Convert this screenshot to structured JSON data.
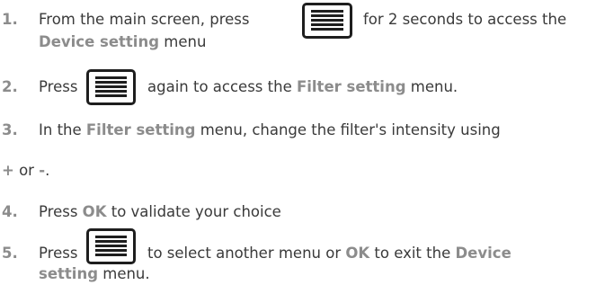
{
  "steps": [
    {
      "number": "1.",
      "line1_before": "From the main screen, press",
      "line1_after": "for 2 seconds to access the",
      "line2_highlight": "Device setting",
      "line2_after": " menu"
    },
    {
      "number": "2.",
      "text_before": "Press",
      "text_middle": "again to access the ",
      "text_highlight": "Filter setting",
      "text_after": " menu."
    },
    {
      "number": "3.",
      "text_before": "In the ",
      "text_highlight": "Filter setting",
      "text_after": " menu, change the filter's intensity using",
      "cont_plus": "+",
      "cont_or": " or ",
      "cont_minus": "-",
      "cont_end": "."
    },
    {
      "number": "4.",
      "text_before": "Press ",
      "text_highlight": "OK",
      "text_after": " to validate your choice"
    },
    {
      "number": "5.",
      "text_before": "Press",
      "text_middle": "to select another menu or ",
      "text_ok": "OK",
      "text_mid2": " to exit the ",
      "text_highlight1": "Device",
      "line2_highlight": "setting",
      "line2_after": " menu."
    }
  ],
  "icons": {
    "menu_button": "menu-lines-icon"
  },
  "colors": {
    "highlight": "#8c8c8c",
    "text": "#3a3a3a",
    "icon": "#1e1e1e"
  }
}
